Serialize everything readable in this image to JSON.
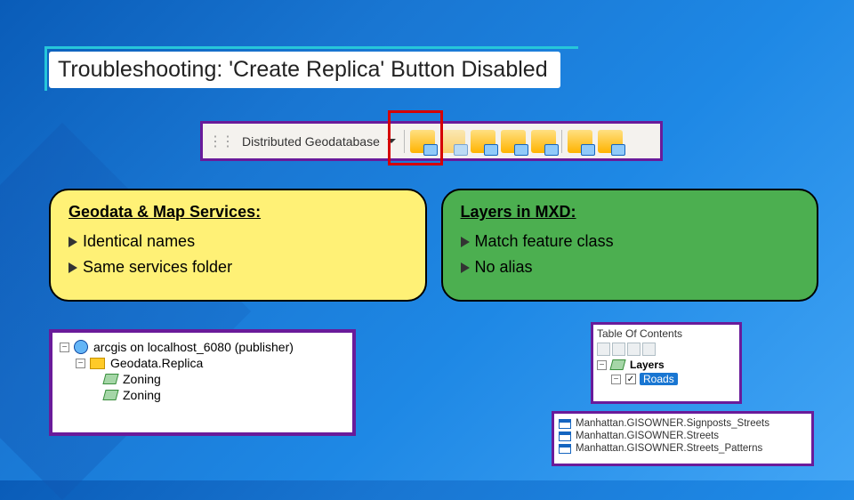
{
  "title": "Troubleshooting: 'Create Replica' Button Disabled",
  "toolbar": {
    "label": "Distributed Geodatabase"
  },
  "cards": {
    "left": {
      "heading": "Geodata & Map Services:",
      "items": [
        "Identical names",
        "Same services folder"
      ]
    },
    "right": {
      "heading": "Layers in MXD:",
      "items": [
        "Match feature class",
        "No alias"
      ]
    }
  },
  "tree": {
    "server": "arcgis on localhost_6080 (publisher)",
    "folder": "Geodata.Replica",
    "services": [
      "Zoning",
      "Zoning"
    ]
  },
  "toc": {
    "title": "Table Of Contents",
    "group": "Layers",
    "selected": "Roads"
  },
  "layer_list": [
    "Manhattan.GISOWNER.Signposts_Streets",
    "Manhattan.GISOWNER.Streets",
    "Manhattan.GISOWNER.Streets_Patterns"
  ]
}
